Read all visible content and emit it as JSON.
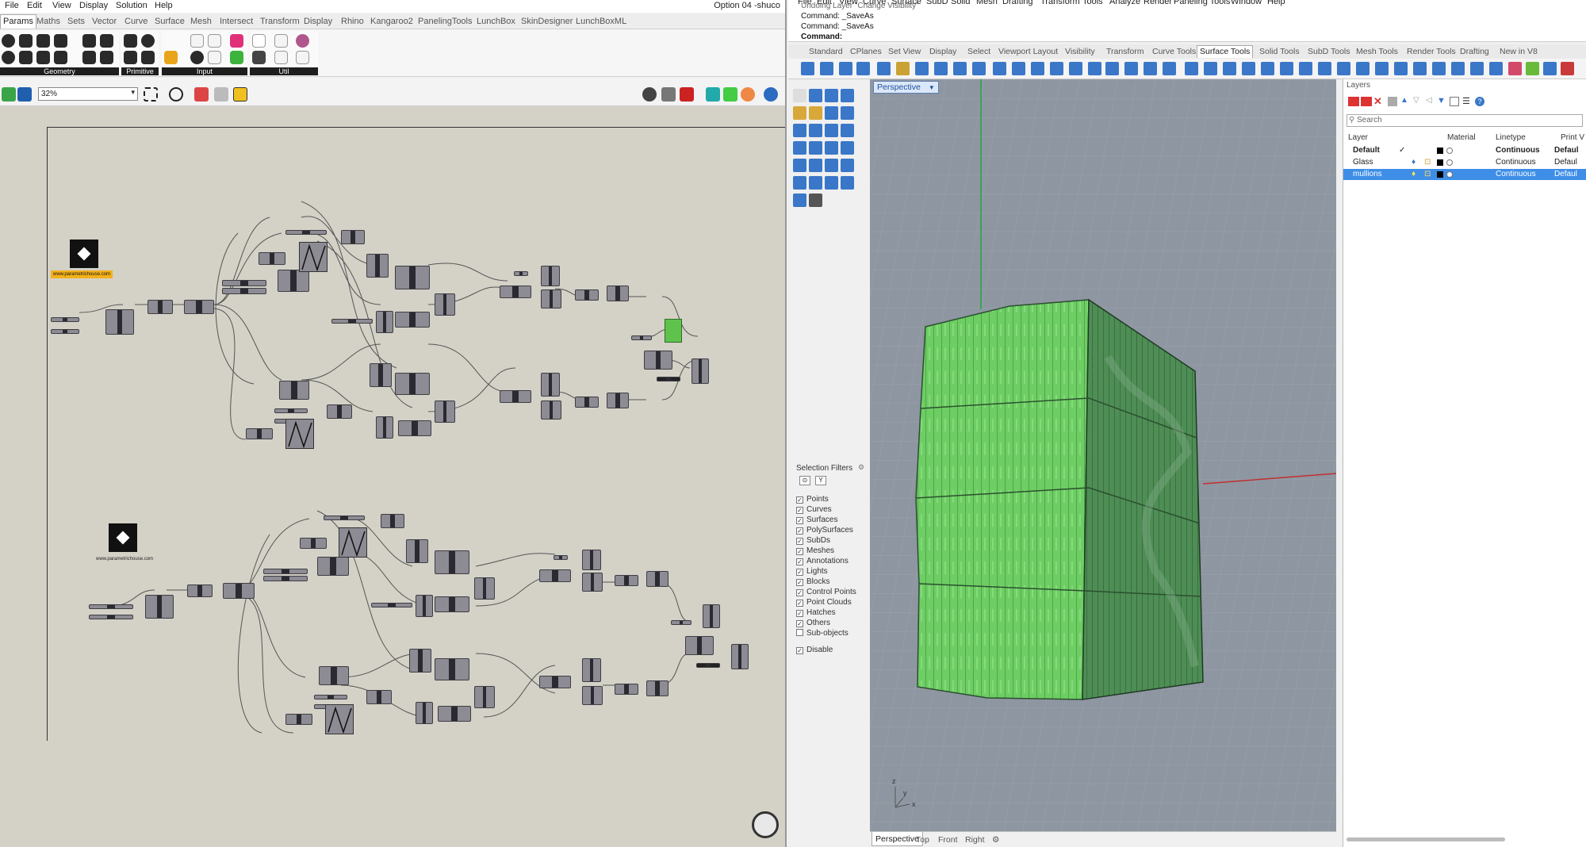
{
  "gh": {
    "menu": [
      "File",
      "Edit",
      "View",
      "Display",
      "Solution",
      "Help"
    ],
    "title": "Option 04 -shuco",
    "tabs": [
      "Params",
      "Maths",
      "Sets",
      "Vector",
      "Curve",
      "Surface",
      "Mesh",
      "Intersect",
      "Transform",
      "Display",
      "Rhino",
      "Kangaroo2",
      "PanelingTools",
      "LunchBox",
      "SkinDesigner",
      "LunchBoxML"
    ],
    "active_tab": "Params",
    "groups": [
      "Geometry",
      "Primitive",
      "Input",
      "Util"
    ],
    "zoom": "32%",
    "logo_url_1": "www.parametrichouse.com",
    "logo_url_2": "www.parametrichouse.com",
    "colors": {
      "canvas": "#d4d1c7",
      "component": "#8d8b93",
      "preview_green": "#5fc24d",
      "url_tag": "#f3b11a"
    }
  },
  "rhino": {
    "menu": [
      "File",
      "Edit",
      "View",
      "Curve",
      "Surface",
      "SubD",
      "Solid",
      "Mesh",
      "Drafting",
      "Transform",
      "Tools",
      "Analyze",
      "Render",
      "Paneling Tools",
      "Window",
      "Help"
    ],
    "command_history": [
      "Undoing Layer \"Change Visibility\"",
      "Command: _SaveAs",
      "Command: _SaveAs"
    ],
    "command_prompt": "Command:",
    "tabs": [
      "Standard",
      "CPlanes",
      "Set View",
      "Display",
      "Select",
      "Viewport Layout",
      "Visibility",
      "Transform",
      "Curve Tools",
      "Surface Tools",
      "Solid Tools",
      "SubD Tools",
      "Mesh Tools",
      "Render Tools",
      "Drafting",
      "New in V8"
    ],
    "active_tab": "Surface Tools",
    "viewport_name": "Perspective",
    "viewport_tabs": [
      "Perspective",
      "Top",
      "Front",
      "Right"
    ],
    "axis_labels": {
      "x": "x",
      "y": "y",
      "z": "z"
    },
    "selection_filters": {
      "title": "Selection Filters",
      "items": [
        {
          "label": "Points",
          "checked": true
        },
        {
          "label": "Curves",
          "checked": true
        },
        {
          "label": "Surfaces",
          "checked": true
        },
        {
          "label": "PolySurfaces",
          "checked": true
        },
        {
          "label": "SubDs",
          "checked": true
        },
        {
          "label": "Meshes",
          "checked": true
        },
        {
          "label": "Annotations",
          "checked": true
        },
        {
          "label": "Lights",
          "checked": true
        },
        {
          "label": "Blocks",
          "checked": true
        },
        {
          "label": "Control Points",
          "checked": true
        },
        {
          "label": "Point Clouds",
          "checked": true
        },
        {
          "label": "Hatches",
          "checked": true
        },
        {
          "label": "Others",
          "checked": true
        },
        {
          "label": "Sub-objects",
          "checked": false
        }
      ],
      "disable": {
        "label": "Disable",
        "checked": true
      }
    },
    "layers": {
      "title": "Layers",
      "search_placeholder": "Search",
      "columns": [
        "Layer",
        "Material",
        "Linetype",
        "Print V"
      ],
      "rows": [
        {
          "name": "Default",
          "linetype": "Continuous",
          "print": "Defaul",
          "current": true,
          "selected": false
        },
        {
          "name": "Glass",
          "linetype": "Continuous",
          "print": "Defaul",
          "current": false,
          "selected": false
        },
        {
          "name": "mullions",
          "linetype": "Continuous",
          "print": "Defaul",
          "current": false,
          "selected": true
        }
      ]
    },
    "colors": {
      "viewport_bg": "#8e96a1",
      "mesh_green": "#6dce63",
      "mesh_dark": "#4e8e55",
      "selection": "#3e8ee8"
    }
  }
}
